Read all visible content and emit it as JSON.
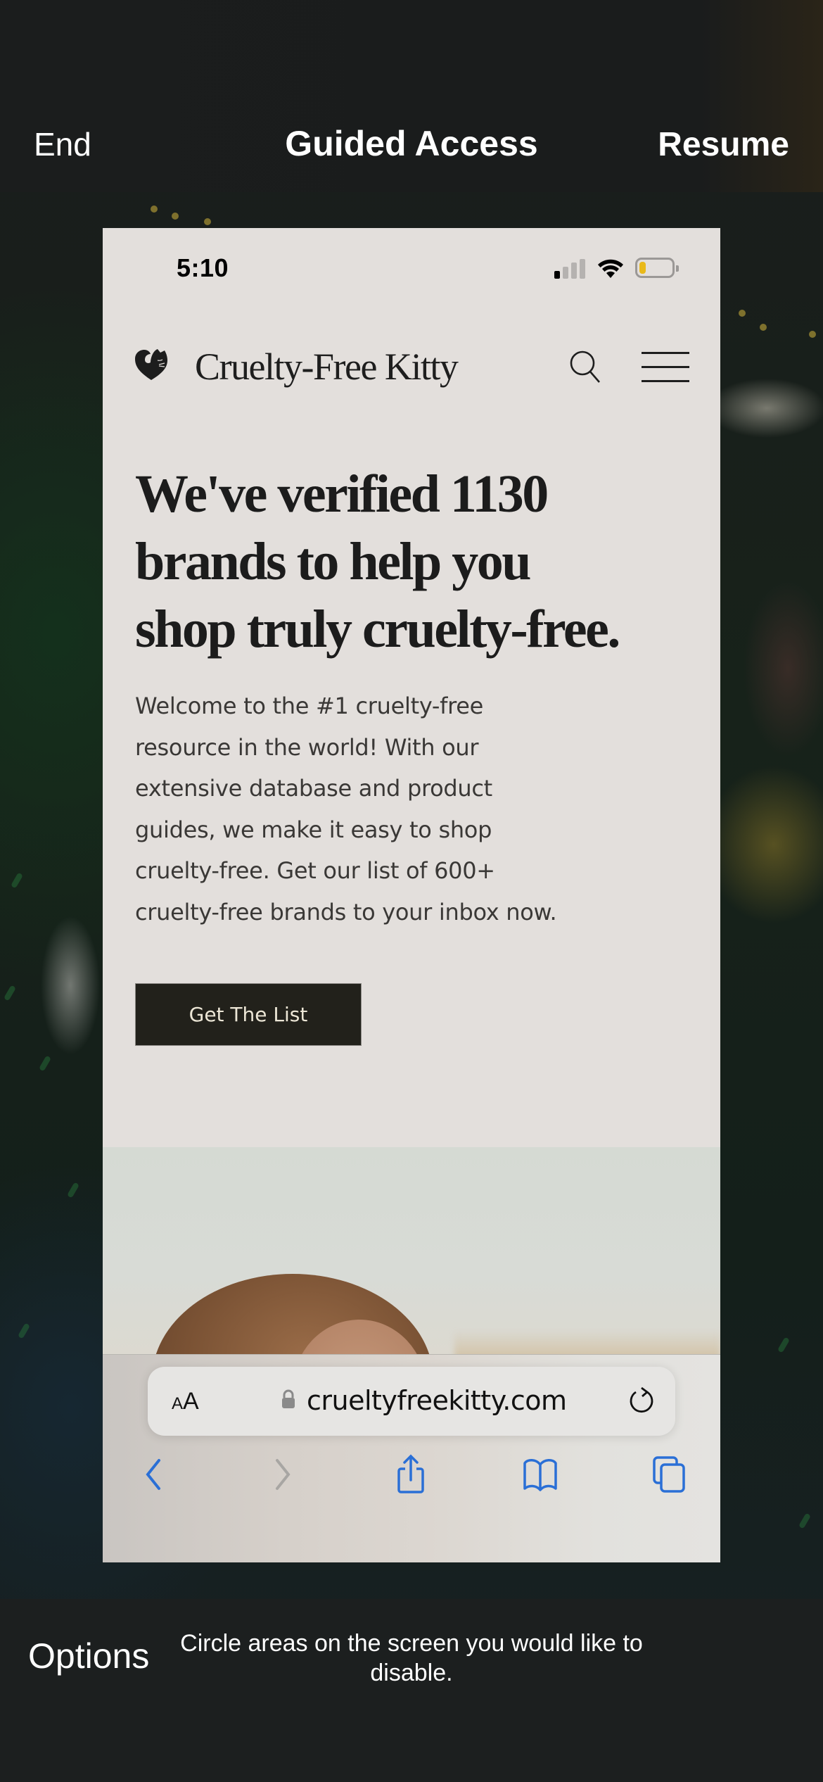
{
  "guided_access": {
    "end_label": "End",
    "title": "Guided Access",
    "resume_label": "Resume",
    "options_label": "Options",
    "instruction": "Circle areas on the screen you would like to disable."
  },
  "status_bar": {
    "time": "5:10",
    "signal_bars_active": 1,
    "signal_bars_total": 4,
    "wifi": "full",
    "battery_level": 0.2,
    "battery_color": "#e9b91a"
  },
  "site": {
    "logo_icon": "heart-cat-icon",
    "title": "Cruelty-Free Kitty",
    "search_icon": "search-icon",
    "menu_icon": "hamburger-menu-icon",
    "headline_lines": [
      "We've verified 1130",
      "brands to help you",
      "shop truly cruelty-free."
    ],
    "intro_lines": [
      "Welcome to the #1 cruelty-free",
      "resource in the world! With our",
      "extensive database and product",
      "guides, we make it easy to shop",
      "cruelty-free. Get our list of 600+",
      "cruelty-free brands to your inbox now."
    ],
    "cta_label": "Get The List",
    "cta_bg": "#22211b",
    "cta_text_color": "#ece6d6",
    "page_bg": "#e3dfdc"
  },
  "safari": {
    "text_size_label": "AA",
    "url": "cruelty freekitty.com",
    "url_display": "crueltyfreekitty.com",
    "secure": true,
    "toolbar": [
      {
        "name": "back-icon",
        "enabled": true
      },
      {
        "name": "forward-icon",
        "enabled": false
      },
      {
        "name": "share-icon",
        "enabled": true
      },
      {
        "name": "bookmarks-icon",
        "enabled": true
      },
      {
        "name": "tabs-icon",
        "enabled": true
      }
    ],
    "accent_color": "#2a6fd6"
  }
}
